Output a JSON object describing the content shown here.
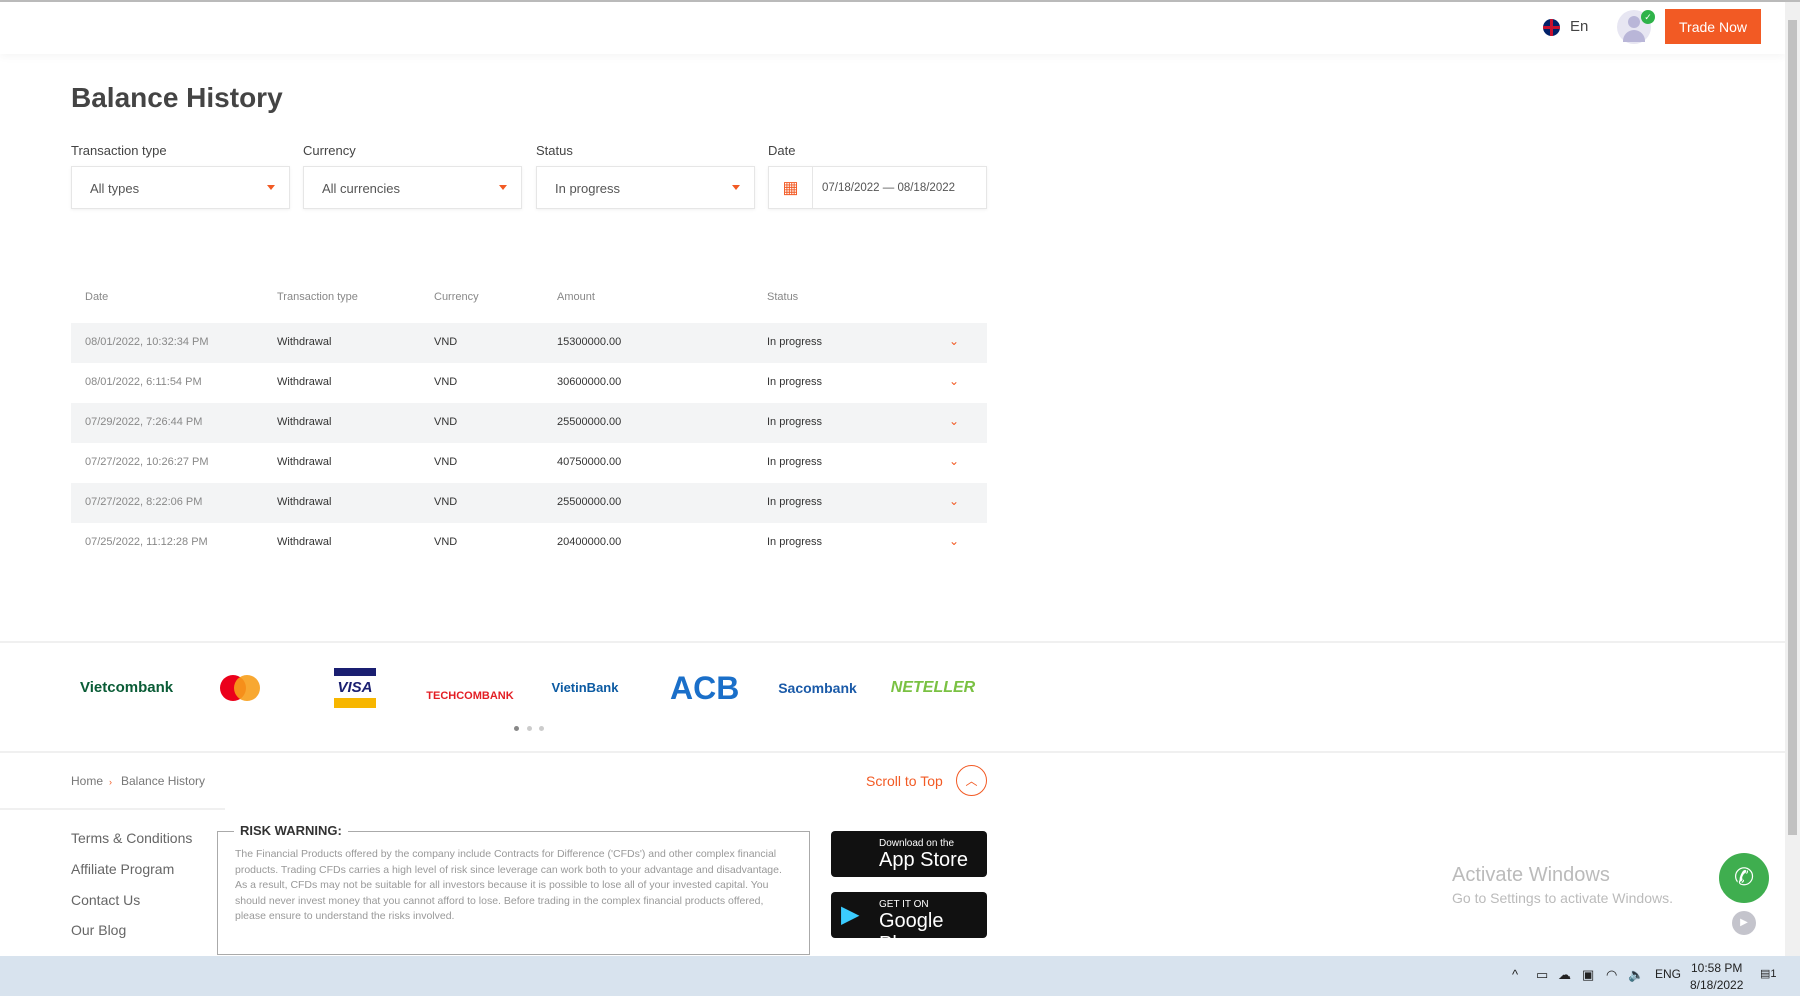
{
  "header": {
    "language": "En",
    "trade_now": "Trade Now"
  },
  "page": {
    "title": "Balance History"
  },
  "filters": {
    "transaction_type": {
      "label": "Transaction type",
      "value": "All types"
    },
    "currency": {
      "label": "Currency",
      "value": "All currencies"
    },
    "status": {
      "label": "Status",
      "value": "In progress"
    },
    "date": {
      "label": "Date",
      "value": "07/18/2022 — 08/18/2022"
    }
  },
  "table": {
    "headers": [
      "Date",
      "Transaction type",
      "Currency",
      "Amount",
      "Status"
    ],
    "rows": [
      [
        "08/01/2022, 10:32:34 PM",
        "Withdrawal",
        "VND",
        "15300000.00",
        "In progress"
      ],
      [
        "08/01/2022, 6:11:54 PM",
        "Withdrawal",
        "VND",
        "30600000.00",
        "In progress"
      ],
      [
        "07/29/2022, 7:26:44 PM",
        "Withdrawal",
        "VND",
        "25500000.00",
        "In progress"
      ],
      [
        "07/27/2022, 10:26:27 PM",
        "Withdrawal",
        "VND",
        "40750000.00",
        "In progress"
      ],
      [
        "07/27/2022, 8:22:06 PM",
        "Withdrawal",
        "VND",
        "25500000.00",
        "In progress"
      ],
      [
        "07/25/2022, 11:12:28 PM",
        "Withdrawal",
        "VND",
        "20400000.00",
        "In progress"
      ]
    ]
  },
  "partners": [
    "Vietcombank",
    "Mastercard",
    "VISA",
    "TECHCOMBANK",
    "VietinBank",
    "ACB",
    "Sacombank",
    "NETELLER"
  ],
  "breadcrumb": {
    "home": "Home",
    "current": "Balance History"
  },
  "scroll_to_top": "Scroll to Top",
  "footer": {
    "links": [
      "Terms & Conditions",
      "Affiliate Program",
      "Contact Us",
      "Our Blog"
    ],
    "risk_title": "RISK WARNING:",
    "risk_text": "The Financial Products offered by the company include Contracts for Difference ('CFDs') and other complex financial products. Trading CFDs carries a high level of risk since leverage can work both to your advantage and disadvantage. As a result, CFDs may not be suitable for all investors because it is possible to lose all of your invested capital. You should never invest money that you cannot afford to lose. Before trading in the complex financial products offered, please ensure to understand the risks involved.",
    "app_store": {
      "small": "Download on the",
      "large": "App Store"
    },
    "google_play": {
      "small": "GET IT ON",
      "large": "Google Play"
    }
  },
  "windows": {
    "activate_title": "Activate Windows",
    "activate_sub": "Go to Settings to activate Windows.",
    "lang": "ENG",
    "time": "10:58 PM",
    "date": "8/18/2022",
    "notifications": "1"
  },
  "colors": {
    "accent": "#f25a24",
    "phone": "#3fae4f"
  }
}
